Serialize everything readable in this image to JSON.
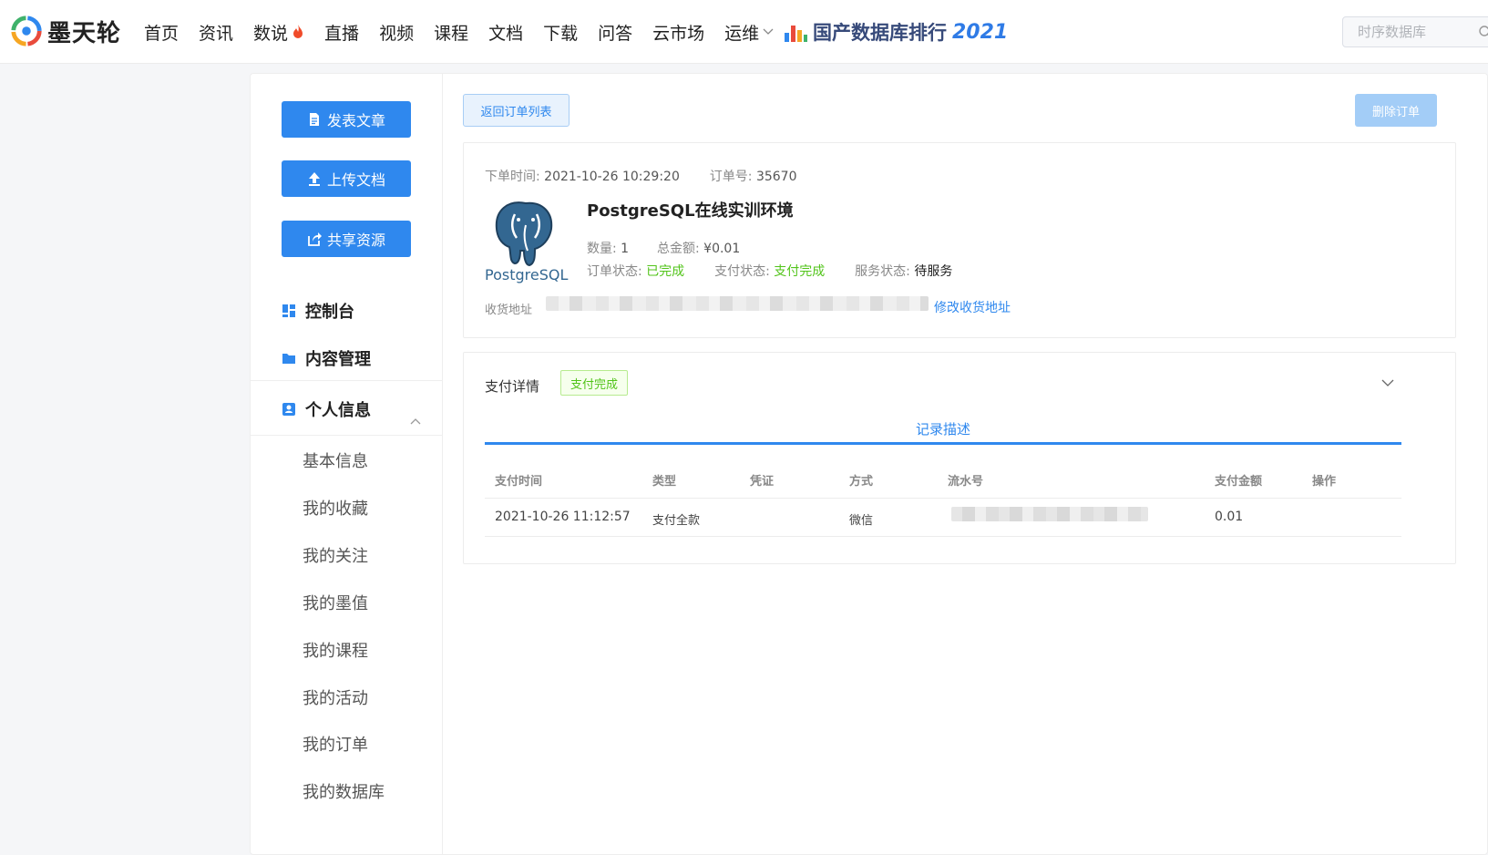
{
  "site": {
    "name": "墨天轮",
    "nav": [
      {
        "label": "首页"
      },
      {
        "label": "资讯"
      },
      {
        "label": "数说",
        "hot": true
      },
      {
        "label": "直播"
      },
      {
        "label": "视频"
      },
      {
        "label": "课程"
      },
      {
        "label": "文档"
      },
      {
        "label": "下载"
      },
      {
        "label": "问答"
      },
      {
        "label": "云市场"
      },
      {
        "label": "运维",
        "dropdown": true
      }
    ],
    "ranking_label": "国产数据库排行",
    "ranking_year": "2021",
    "search_placeholder": "时序数据库",
    "accent": "#2f88ee"
  },
  "sidebar": {
    "buttons": [
      {
        "label": "发表文章",
        "icon": "document-icon"
      },
      {
        "label": "上传文档",
        "icon": "upload-icon"
      },
      {
        "label": "共享资源",
        "icon": "share-icon"
      }
    ],
    "sections": [
      {
        "label": "控制台",
        "icon": "dashboard-icon"
      },
      {
        "label": "内容管理",
        "icon": "folder-icon"
      },
      {
        "label": "个人信息",
        "icon": "user-card-icon",
        "expanded": true
      }
    ],
    "sub_items": [
      "基本信息",
      "我的收藏",
      "我的关注",
      "我的墨值",
      "我的课程",
      "我的活动",
      "我的订单",
      "我的数据库"
    ]
  },
  "order": {
    "back_label": "返回订单列表",
    "delete_label": "删除订单",
    "order_time_label": "下单时间:",
    "order_time": "2021-10-26 10:29:20",
    "order_no_label": "订单号:",
    "order_no": "35670",
    "product_logo_text": "PostgreSQL",
    "product_title": "PostgreSQL在线实训环境",
    "qty_label": "数量:",
    "qty": "1",
    "total_label": "总金额:",
    "total": "¥0.01",
    "order_status_label": "订单状态:",
    "order_status": "已完成",
    "pay_status_label": "支付状态:",
    "pay_status": "支付完成",
    "service_status_label": "服务状态:",
    "service_status": "待服务",
    "address_label": "收货地址",
    "address_edit": "修改收货地址",
    "status_green": "#52c41a"
  },
  "payment": {
    "title": "支付详情",
    "badge": "支付完成",
    "tab": "记录描述",
    "columns": [
      "支付时间",
      "类型",
      "凭证",
      "方式",
      "流水号",
      "支付金额",
      "操作"
    ],
    "rows": [
      {
        "time": "2021-10-26 11:12:57",
        "type": "支付全款",
        "voucher": "",
        "method": "微信",
        "serial": "",
        "amount": "0.01",
        "action": ""
      }
    ]
  }
}
